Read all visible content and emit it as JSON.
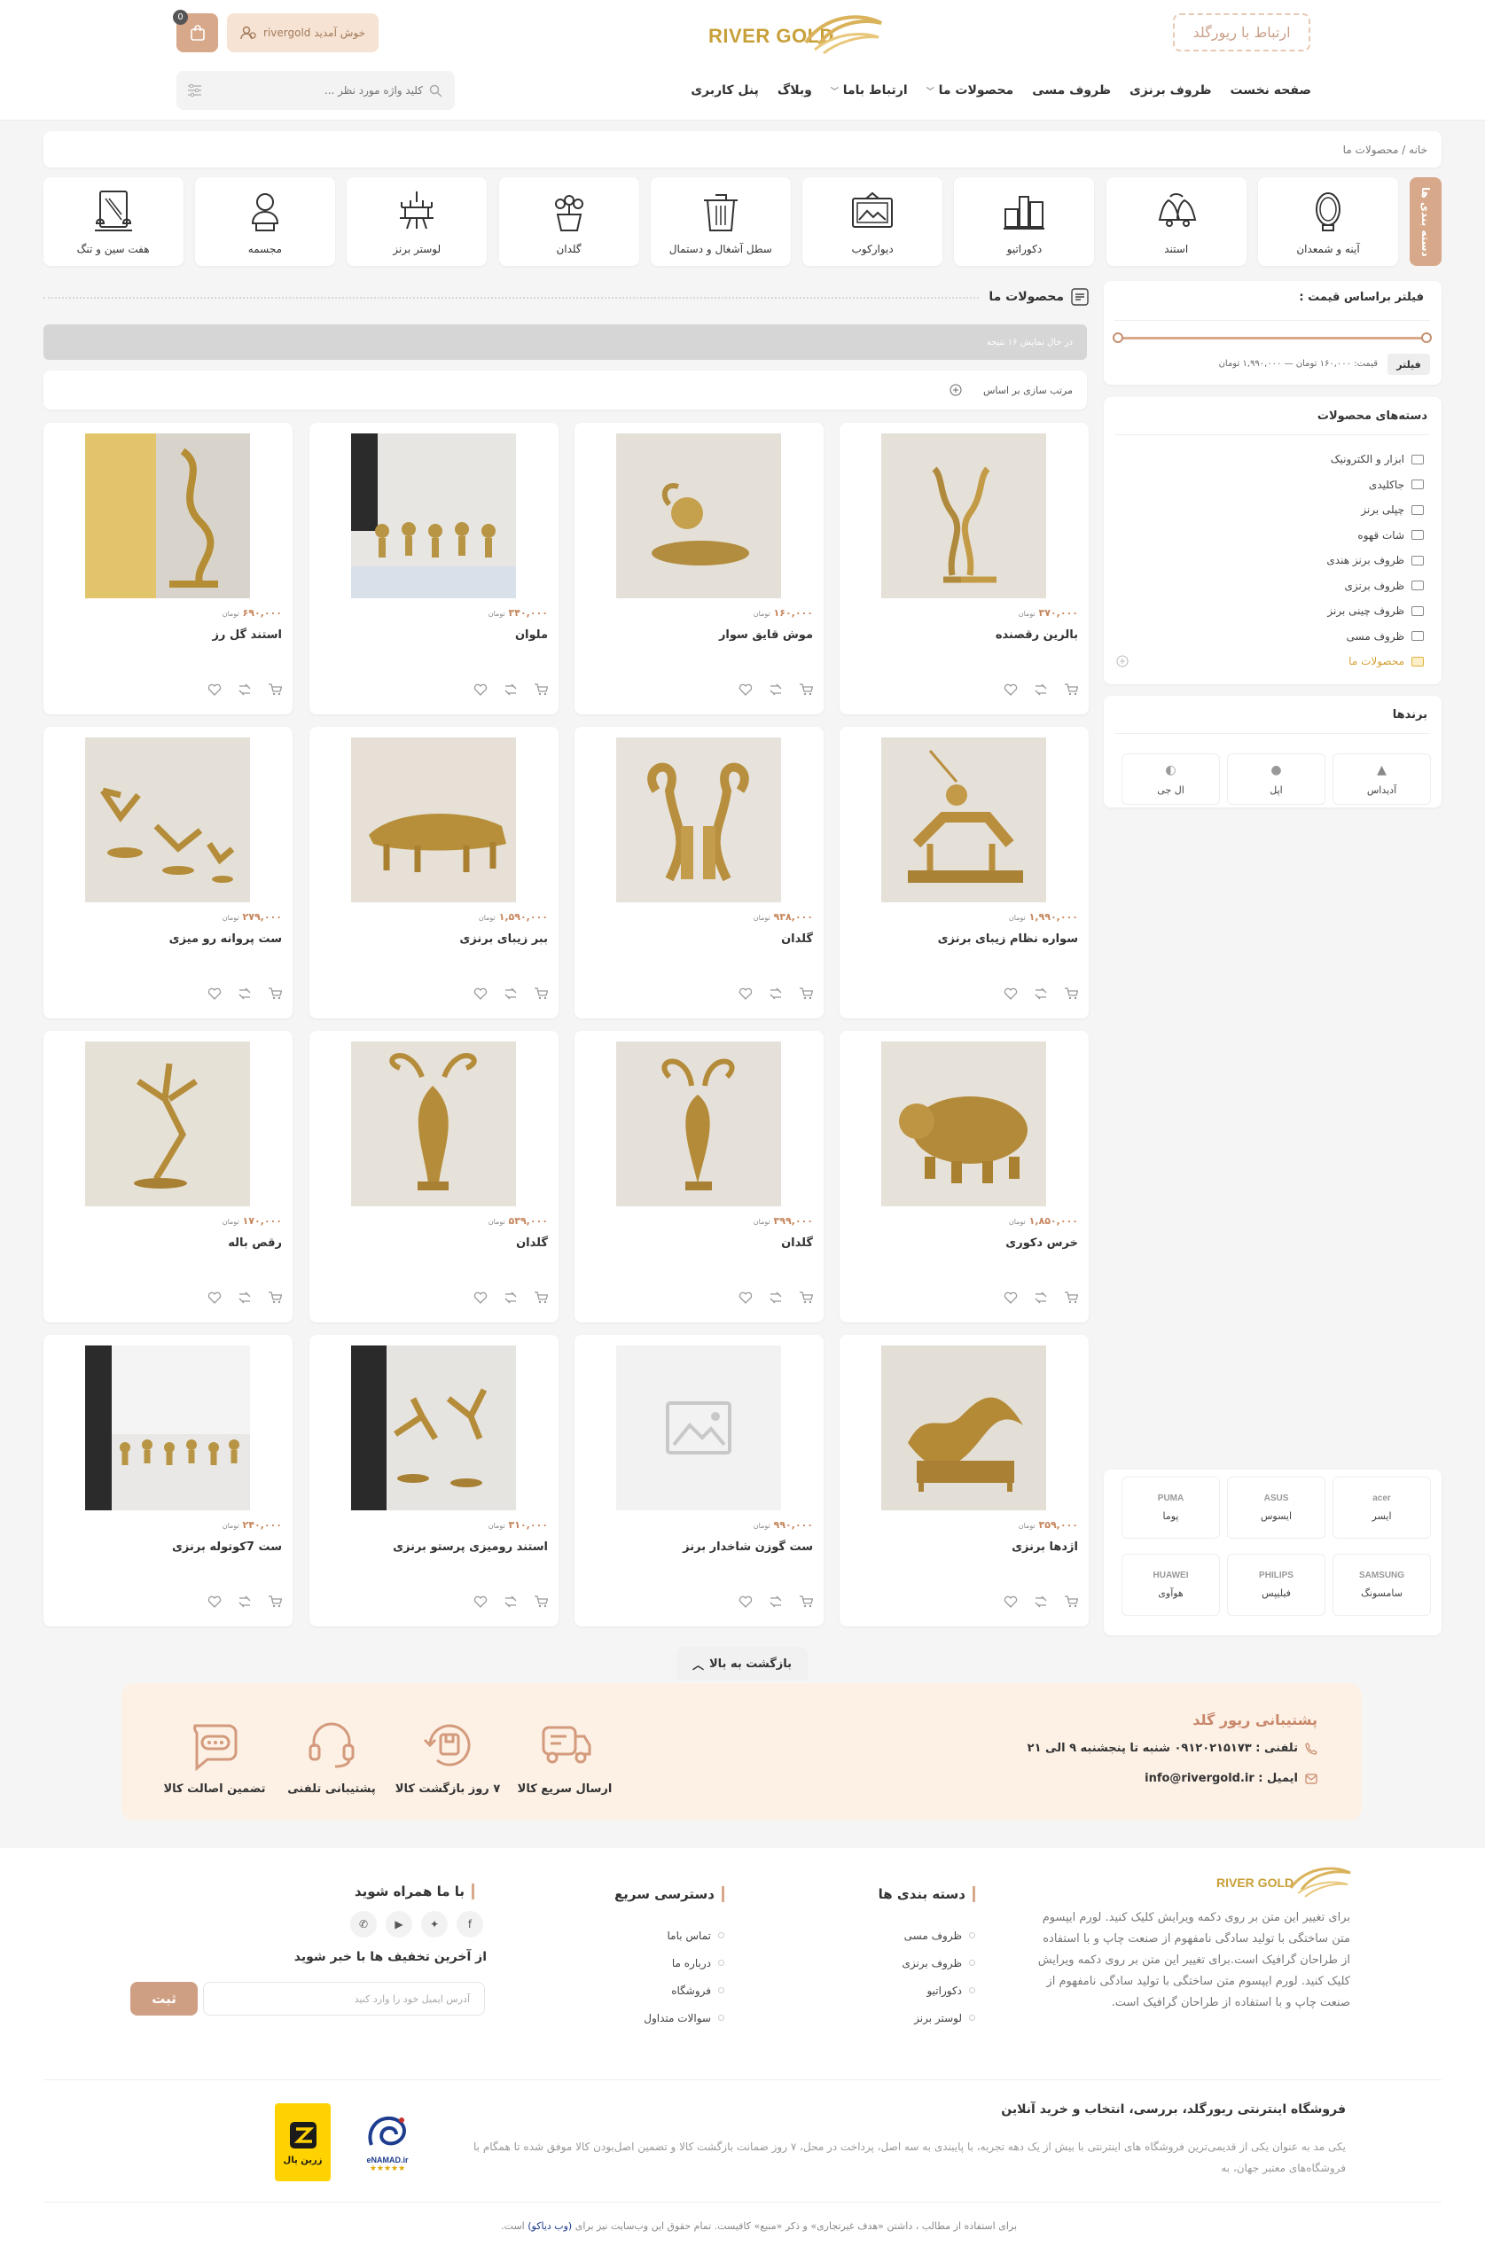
{
  "header": {
    "brand": "RIVER GOLD",
    "contact_button": "ارتباط با ریورگلد",
    "welcome": "خوش آمدید rivergold",
    "cart_count": "0",
    "search_placeholder": "کلید واژه مورد نظر ...",
    "nav": [
      "صفحه نخست",
      "ظروف برنزی",
      "ظروف مسی",
      "محصولات ما",
      "ارتباط باما",
      "وبلاگ",
      "پنل کاربری"
    ]
  },
  "breadcrumb": "خانه / محصولات ما",
  "categories_tab": "دسته بندی ها",
  "categories": [
    {
      "label": "آینه و شمعدان",
      "icon": "mirror-icon"
    },
    {
      "label": "استند",
      "icon": "bells-icon"
    },
    {
      "label": "دکوراتیو",
      "icon": "decor-icon"
    },
    {
      "label": "دیوارکوب",
      "icon": "frame-icon"
    },
    {
      "label": "سطل آشغال و دستمال",
      "icon": "trash-icon"
    },
    {
      "label": "گلدان",
      "icon": "flower-pot-icon"
    },
    {
      "label": "لوستر برنز",
      "icon": "chandelier-icon"
    },
    {
      "label": "مجسمه",
      "icon": "bust-icon"
    },
    {
      "label": "هفت سین و تنگ",
      "icon": "mirror-frame-icon"
    }
  ],
  "products_section": {
    "title": "محصولات ما",
    "status": "در حال نمایش ۱۶ نتیجه",
    "sort_label": "مرتب سازی بر اساس"
  },
  "currency": "تومان",
  "products": [
    {
      "name": "بالرین رقصنده",
      "price": "۳۷۰,۰۰۰"
    },
    {
      "name": "موش قایق سوار",
      "price": "۱۶۰,۰۰۰"
    },
    {
      "name": "ملوان",
      "price": "۳۴۰,۰۰۰"
    },
    {
      "name": "استند گل رز",
      "price": "۶۹۰,۰۰۰"
    },
    {
      "name": "سواره نظام زیبای برنزی",
      "price": "۱,۹۹۰,۰۰۰"
    },
    {
      "name": "گلدان",
      "price": "۹۳۸,۰۰۰"
    },
    {
      "name": "ببر زیبای برنزی",
      "price": "۱,۵۹۰,۰۰۰"
    },
    {
      "name": "ست پروانه رو میزی",
      "price": "۲۷۹,۰۰۰"
    },
    {
      "name": "خرس دکوری",
      "price": "۱,۸۵۰,۰۰۰"
    },
    {
      "name": "گلدان",
      "price": "۳۹۹,۰۰۰"
    },
    {
      "name": "گلدان",
      "price": "۵۳۹,۰۰۰"
    },
    {
      "name": "رقص باله",
      "price": "۱۷۰,۰۰۰"
    },
    {
      "name": "اژدها برنزی",
      "price": "۳۵۹,۰۰۰"
    },
    {
      "name": "ست گوزن شاخدار برنز",
      "price": "۹۹۰,۰۰۰"
    },
    {
      "name": "استند رومیزی پرستو برنزی",
      "price": "۳۱۰,۰۰۰"
    },
    {
      "name": "ست 7کوتوله برنزی",
      "price": "۲۴۰,۰۰۰"
    }
  ],
  "price_filter": {
    "title": "فیلتر براساس قیمت :",
    "range_text": "قیمت: ۱۶۰,۰۰۰ تومان — ۱,۹۹۰,۰۰۰ تومان",
    "button": "فیلتر"
  },
  "product_categories": {
    "title": "دسته‌های محصولات",
    "items": [
      "ابزار و الکترونیک",
      "جاکلیدی",
      "چپلی برنز",
      "شات قهوه",
      "ظروف برنز هندی",
      "ظروف برنزی",
      "ظروف چینی برنز",
      "ظروف مسی",
      "محصولات ما"
    ]
  },
  "brands": {
    "title": "برندها",
    "top": [
      "آدیداس",
      "اپل",
      "ال جی"
    ],
    "bottom": [
      {
        "name": "ایسر",
        "logo": "acer"
      },
      {
        "name": "ایسوس",
        "logo": "ASUS"
      },
      {
        "name": "پوما",
        "logo": "PUMA"
      },
      {
        "name": "سامسونگ",
        "logo": "SAMSUNG"
      },
      {
        "name": "فیلیپس",
        "logo": "PHILIPS"
      },
      {
        "name": "هوآوی",
        "logo": "HUAWEI"
      }
    ]
  },
  "back_to_top": "بازگشت به بالا",
  "support": {
    "title": "پشتیبانی ریور گلد",
    "phone": "تلفنی : ۰۹۱۲۰۲۱۵۱۷۳ شنبه تا پنجشنبه ۹ الی ۲۱",
    "email": "ایمیل : info@rivergold.ir",
    "features": [
      "ارسال سریع کالا",
      "۷ روز بازگشت کالا",
      "پشتیبانی تلفنی",
      "تضمین اصالت کالا"
    ]
  },
  "footer": {
    "brand": "RIVER GOLD",
    "about": "برای تغییر این متن بر روی دکمه ویرایش کلیک کنید. لورم ایپسوم متن ساختگی با تولید سادگی نامفهوم از صنعت چاپ و با استفاده از طراحان گرافیک است.برای تغییر این متن بر روی دکمه ویرایش کلیک کنید. لورم ایپسوم متن ساختگی با تولید سادگی نامفهوم از صنعت چاپ و با استفاده از طراحان گرافیک است.",
    "col1_title": "دسته بندی ها",
    "col1": [
      "ظروف مسی",
      "ظروف برنزی",
      "دکوراتیو",
      "لوستر برنز"
    ],
    "col2_title": "دسترسی سریع",
    "col2": [
      "تماس باما",
      "درباره ما",
      "فروشگاه",
      "سوالات متداول"
    ],
    "social_title": "با ما همراه شوید",
    "newsletter_title": "از آخرین تخفیف ها با خبر شوید",
    "newsletter_placeholder": "آدرس ایمیل خود را وارد کنید",
    "newsletter_button": "ثبت",
    "shop_title": "فروشگاه اینترنتی ریورگلد، بررسی، انتخاب و خرید آنلاین",
    "shop_desc": "یکی مد به عنوان یکی از قدیمی‌ترین فروشگاه های اینترنتی با بیش از یک دهه تجربه، با پایبندی به سه اصل، پرداخت در محل، ۷ روز ضمانت بازگشت کالا و تضمین اصل‌بودن کالا موفق شده تا همگام با فروشگاه‌های معتبر جهان، به",
    "enamad": "eNAMAD.ir",
    "zarinpal": "زرین پال",
    "copyright_pre": "برای استفاده از مطالب ، داشتن «هدف غیرتجاری» و ذکر «منبع» کافیست. تمام حقوق این وب‌سایت نیز برای",
    "copyright_link": "(وب دیاکو)",
    "copyright_post": "است."
  }
}
